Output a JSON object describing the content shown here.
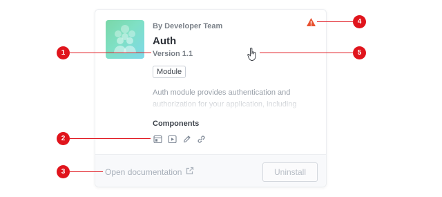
{
  "card": {
    "byline": "By Developer Team",
    "title": "Auth",
    "version": "Version 1.1",
    "tag": "Module",
    "description": "Auth module provides authentication and authorization for your application, including",
    "components_label": "Components",
    "components": [
      {
        "icon": "app-window-icon"
      },
      {
        "icon": "play-square-icon"
      },
      {
        "icon": "pen-icon"
      },
      {
        "icon": "link-icon"
      }
    ],
    "warning_icon": "warning-triangle-icon",
    "open_doc_label": "Open documentation",
    "uninstall_label": "Uninstall"
  },
  "callouts": [
    "1",
    "2",
    "3",
    "4",
    "5"
  ],
  "colors": {
    "callout": "#e0141c",
    "logo_gradient_start": "#7ad7a8",
    "logo_gradient_end": "#7fd9ea",
    "warning": "#e8502f"
  }
}
